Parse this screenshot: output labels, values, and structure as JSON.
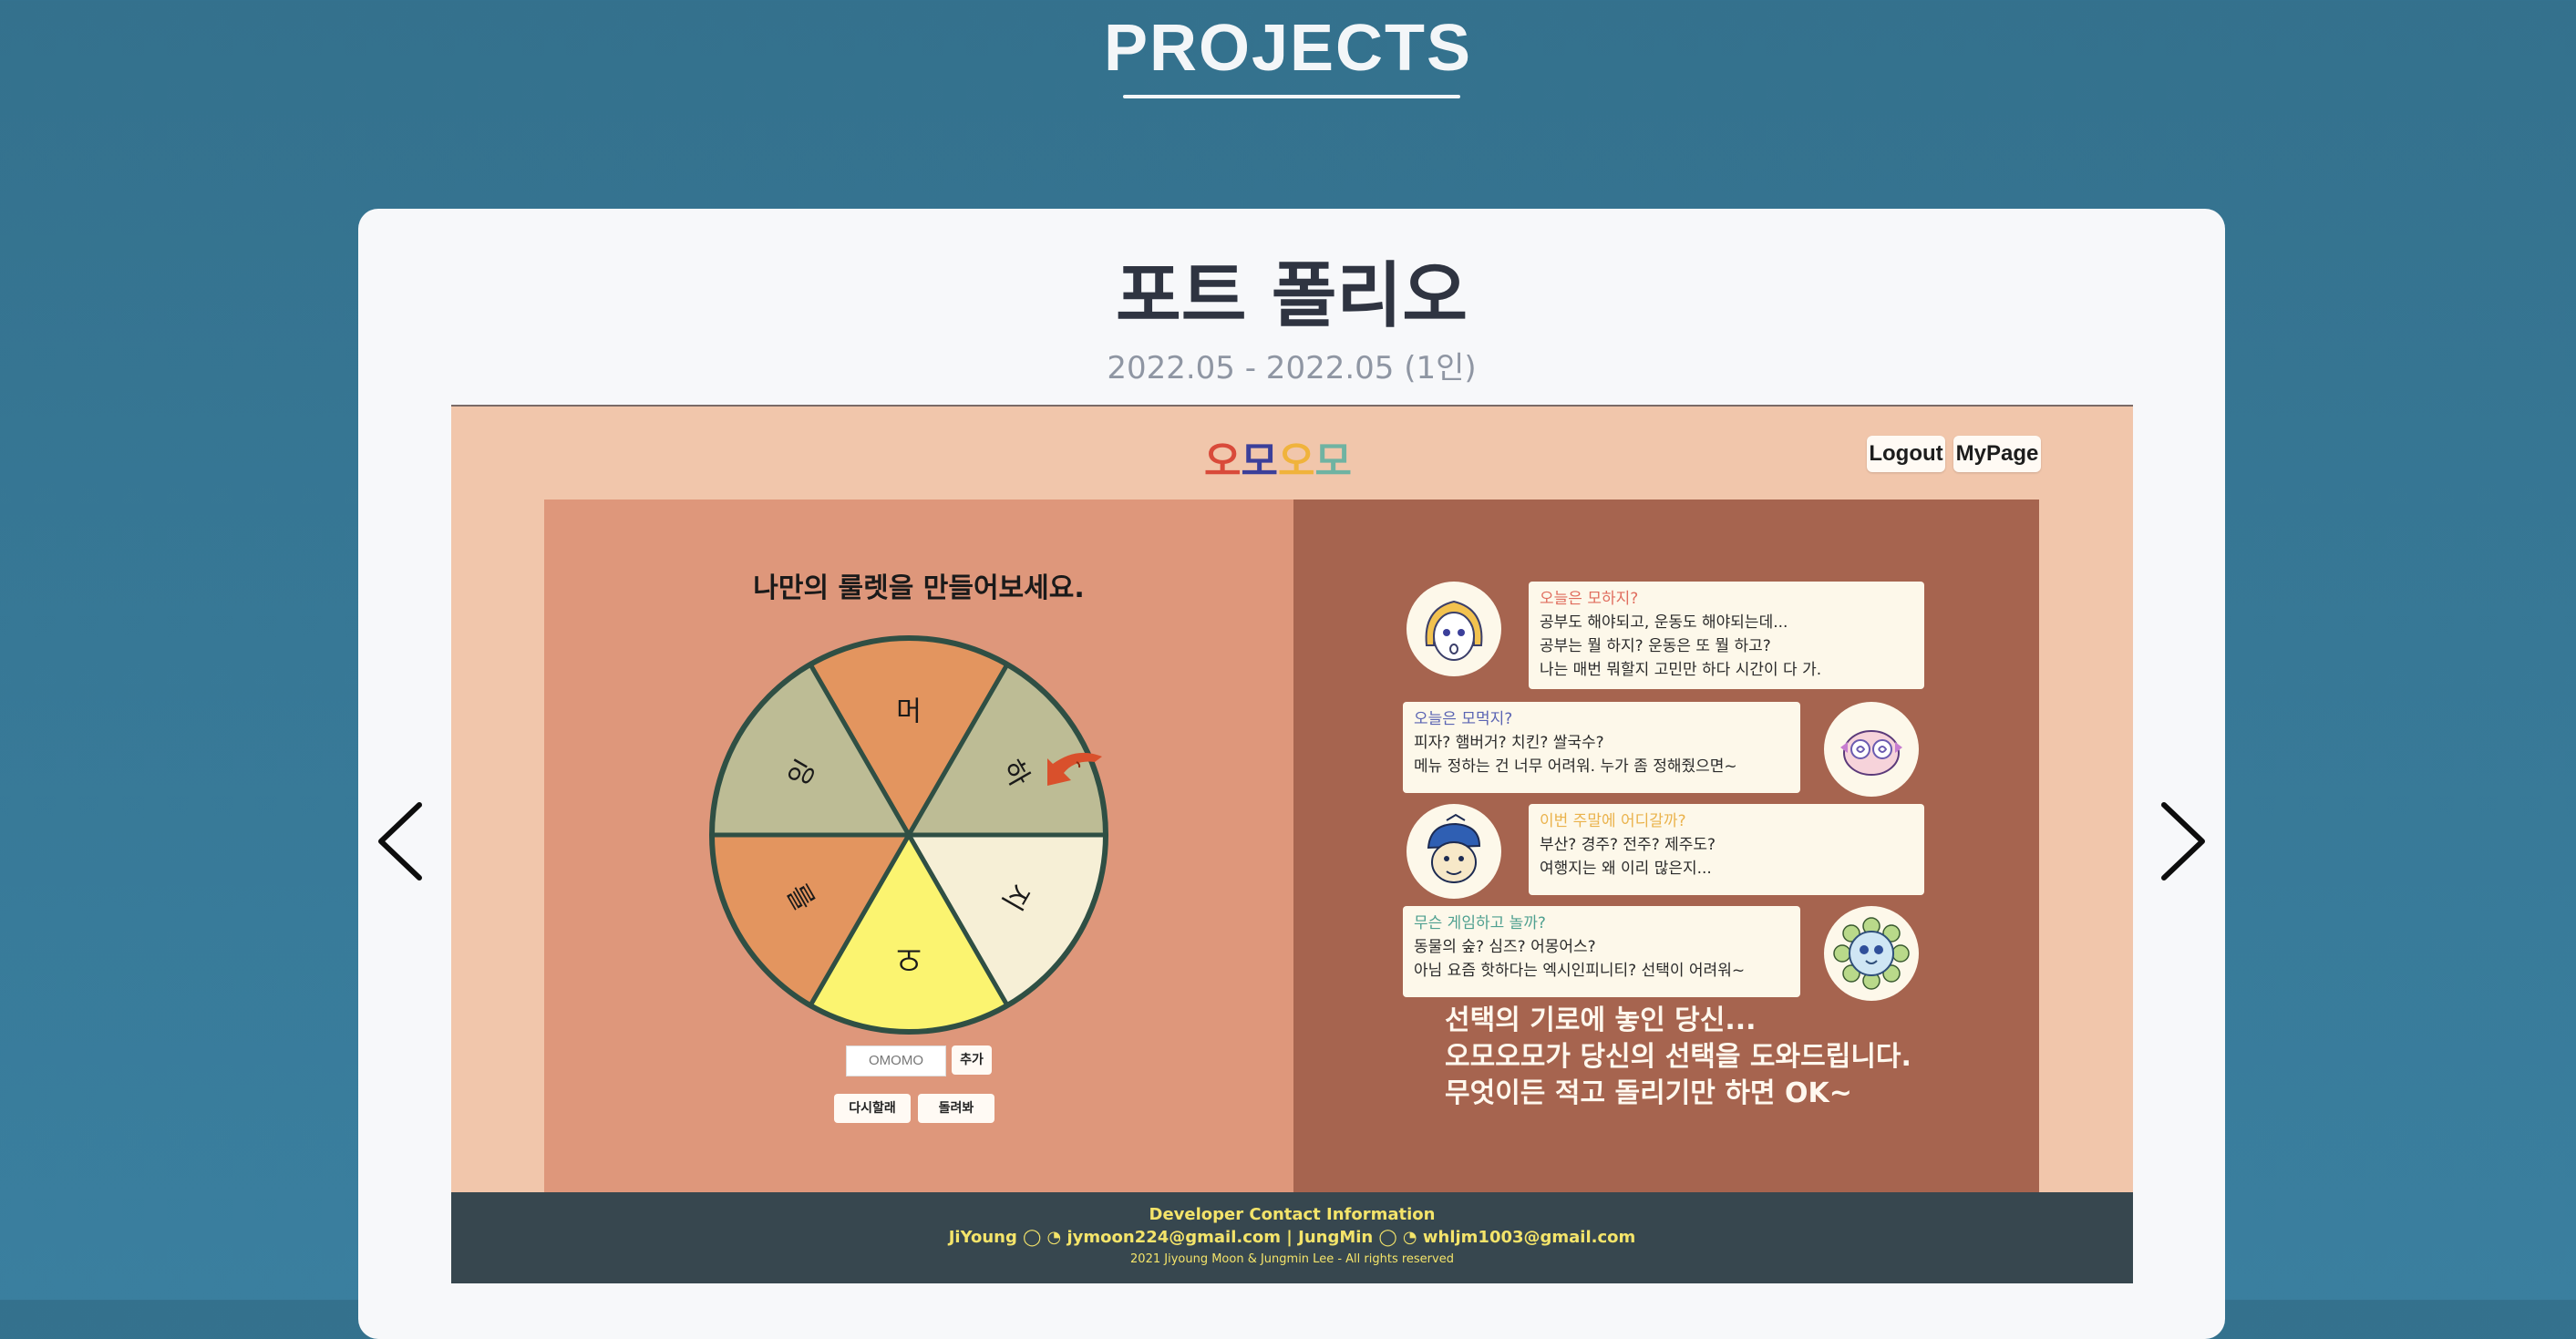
{
  "section": {
    "title": "PROJECTS"
  },
  "project": {
    "title": "포트 폴리오",
    "period": "2022.05 - 2022.05 (1인)"
  },
  "navigation": {
    "prev_icon": "chevron-left-icon",
    "next_icon": "chevron-right-icon"
  },
  "screenshot": {
    "logo": [
      "오",
      "모",
      "오",
      "모"
    ],
    "logo_colors": [
      "#d94a3a",
      "#3b3f9a",
      "#f0b33c",
      "#6fb3a2"
    ],
    "header_buttons": {
      "logout": "Logout",
      "mypage": "MyPage"
    },
    "roulette": {
      "title": "나만의 룰렛을 만들어보세요.",
      "segments": [
        "머",
        "하",
        "지",
        "오",
        "를",
        "잉"
      ],
      "segment_colors": [
        "#e3955f",
        "#bdbc95",
        "#f6efd6",
        "#fbf470",
        "#e3955f",
        "#bdbc95"
      ],
      "input_value": "OMOMO",
      "add_label": "추가",
      "reset_label": "다시할래",
      "spin_label": "돌려봐"
    },
    "bubbles": [
      {
        "question": "오늘은 모하지?",
        "question_color": "#e06d5e",
        "lines": [
          "공부도 해야되고, 운동도 해야되는데...",
          "공부는 뭘 하지? 운동은 또 뭘 하고?",
          "나는 매번 뭐할지 고민만 하다 시간이 다 가."
        ]
      },
      {
        "question": "오늘은 모먹지?",
        "question_color": "#5a64b3",
        "lines": [
          "피자? 햄버거? 치킨? 쌀국수?",
          "메뉴 정하는 건 너무 어려워. 누가 좀 정해줬으면~"
        ]
      },
      {
        "question": "이번 주말에 어디갈까?",
        "question_color": "#eab24b",
        "lines": [
          "부산? 경주? 전주? 제주도?",
          "여행지는 왜 이리 많은지..."
        ]
      },
      {
        "question": "무슨 게임하고 놀까?",
        "question_color": "#4fa090",
        "lines": [
          "동물의 숲? 심즈? 어몽어스?",
          "아님 요즘 핫하다는 엑시인피니티? 선택이 어려워~"
        ]
      }
    ],
    "slogan": [
      "선택의 기로에 놓인 당신...",
      "오모오모가 당신의 선택을 도와드립니다.",
      "무엇이든 적고 돌리기만 하면 OK~"
    ],
    "footer": {
      "heading": "Developer Contact Information",
      "contacts": "JiYoung ◯ ◔ jymoon224@gmail.com  |  JungMin ◯ ◔ whljm1003@gmail.com",
      "copyright": "2021 Jiyoung Moon & Jungmin Lee - All rights reserved"
    }
  }
}
